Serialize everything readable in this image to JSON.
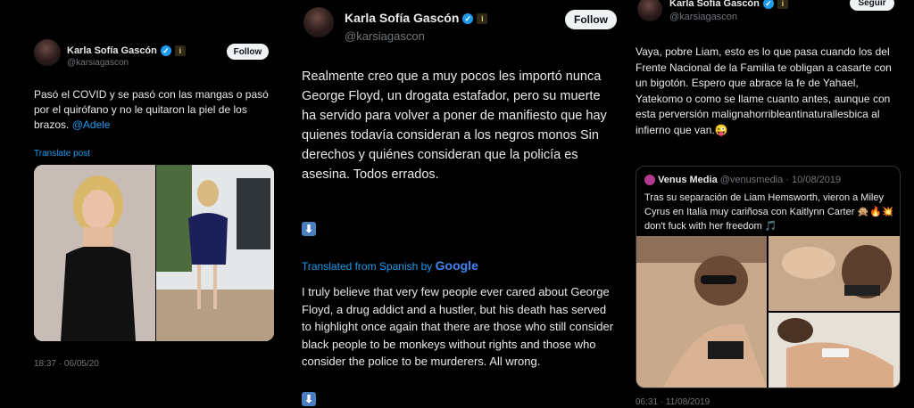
{
  "tweet1": {
    "name": "Karla Sofía Gascón",
    "handle": "@karsiagascon",
    "follow_label": "Follow",
    "body": "Pasó el COVID y se pasó con las mangas o pasó por el quirófano y no le quitaron la piel de los brazos.",
    "mention": "@Adele",
    "translate": "Translate post",
    "timestamp": "18:37 · 06/05/20"
  },
  "tweet2": {
    "name": "Karla Sofía Gascón",
    "handle": "@karsiagascon",
    "follow_label": "Follow",
    "body": "Realmente creo que a muy pocos les importó nunca George Floyd, un drogata estafador, pero su muerte ha servido para volver a poner de manifiesto que hay quienes todavía consideran a los negros monos Sin derechos y quiénes consideran que la policía es asesina. Todos errados.",
    "translated_label": "Translated from Spanish by",
    "google": "Google",
    "translation": "I truly believe that very few people ever cared about George Floyd, a drug addict and a hustler, but his death has served to highlight once again that there are those who still consider black people to be monkeys without rights and those who consider the police to be murderers. All wrong."
  },
  "tweet3": {
    "name": "Karla Sofía Gascón",
    "handle": "@karsiagascon",
    "follow_label": "Seguir",
    "body": "Vaya, pobre Liam, esto es lo que pasa cuando los del Frente Nacional de la Familia te obligan a casarte con un bigotón. Espero que abrace la fe de Yahael, Yatekomo o como se llame cuanto antes, aunque con esta perversión malignahorribleantinaturallesbica al infierno que van.😜",
    "quote": {
      "source": "Venus Media",
      "handle": "@venusmedia",
      "date": "· 10/08/2019",
      "text": "Tras su separación de Liam Hemsworth, vieron a Miley Cyrus en Italia muy cariñosa con Kaitlynn Carter 🙊🔥💥 don't fuck with her freedom 🎵"
    },
    "timestamp": "06:31 · 11/08/2019"
  },
  "icons": {
    "verified": "verified-badge-icon",
    "info": "info-badge-icon",
    "download": "down-arrow-icon"
  },
  "colors": {
    "link": "#1d9bf0",
    "verified": "#1d9bf0",
    "background": "#000000"
  }
}
